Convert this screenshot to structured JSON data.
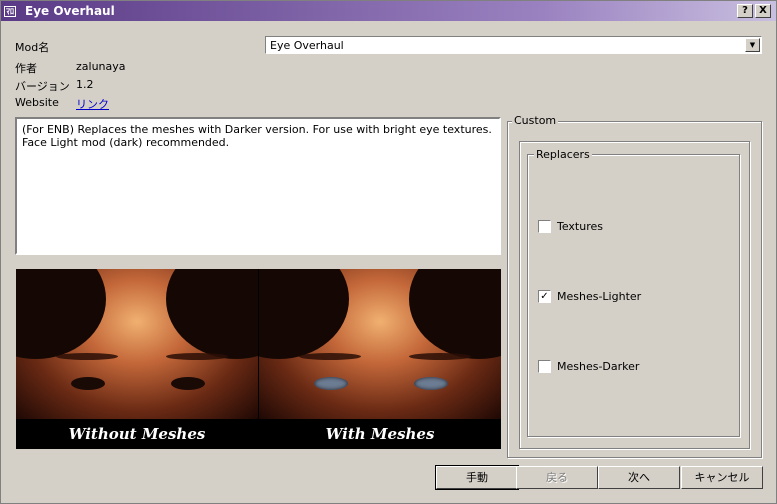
{
  "window": {
    "title": "Eye Overhaul",
    "app_icon_text": "ﾏﾛ",
    "help_button": "?",
    "close_button": "X"
  },
  "info": {
    "mod_name_label": "Mod名",
    "author_label": "作者",
    "author_value": "zalunaya",
    "version_label": "バージョン",
    "version_value": "1.2",
    "website_label": "Website",
    "website_link": "リンク"
  },
  "mod_select": {
    "value": "Eye Overhaul"
  },
  "description": "(For ENB) Replaces the meshes with Darker version. For use with bright eye textures. Face Light mod (dark) recommended.",
  "preview": {
    "left_caption": "Without Meshes",
    "right_caption": "With Meshes"
  },
  "custom": {
    "group_title": "Custom",
    "replacers_title": "Replacers",
    "options": [
      {
        "label": "Textures",
        "checked": false
      },
      {
        "label": "Meshes-Lighter",
        "checked": true
      },
      {
        "label": "Meshes-Darker",
        "checked": false
      }
    ]
  },
  "buttons": {
    "manual": "手動",
    "back": "戻る",
    "next": "次へ",
    "cancel": "キャンセル"
  }
}
